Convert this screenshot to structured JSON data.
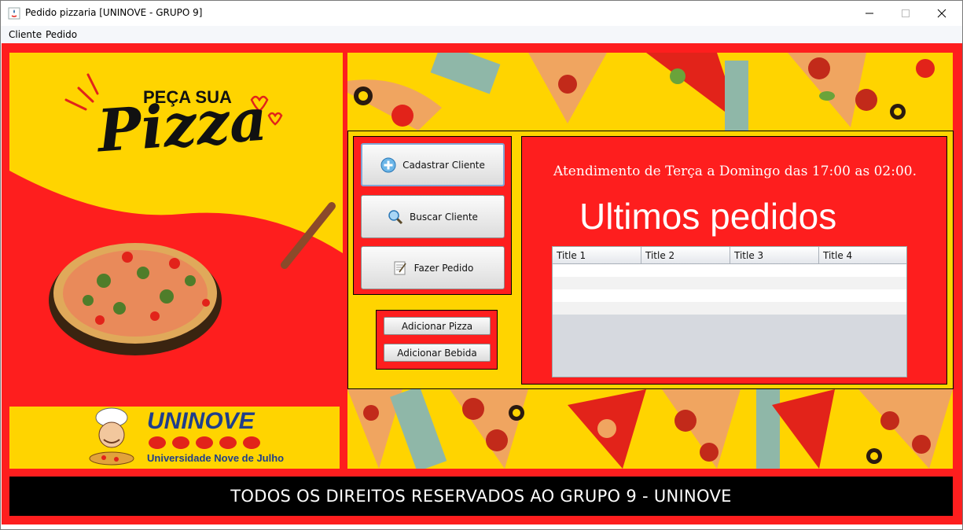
{
  "window": {
    "title": "Pedido pizzaria [UNINOVE - GRUPO 9]"
  },
  "menu": {
    "items": [
      "Cliente",
      "Pedido"
    ]
  },
  "poster": {
    "headline_small": "PEÇA SUA",
    "headline_big": "Pizza"
  },
  "logo": {
    "brand": "UNINOVE",
    "subtitle": "Universidade Nove de Julho"
  },
  "actions": {
    "register_client": "Cadastrar Cliente",
    "search_client": "Buscar Cliente",
    "place_order": "Fazer Pedido",
    "add_pizza": "Adicionar Pizza",
    "add_drink": "Adicionar Bebida"
  },
  "info": {
    "hours": "Atendimento de Terça a Domingo das 17:00 as 02:00.",
    "orders_title": "Ultimos pedidos"
  },
  "orders_table": {
    "columns": [
      "Title 1",
      "Title 2",
      "Title 3",
      "Title 4"
    ]
  },
  "footer": {
    "text": "TODOS OS DIREITOS RESERVADOS AO GRUPO 9 - UNINOVE"
  },
  "colors": {
    "frame_red": "#fe1e1e",
    "yellow": "#ffd400",
    "footer_black": "#000000",
    "brand_blue": "#1f3e8c"
  }
}
